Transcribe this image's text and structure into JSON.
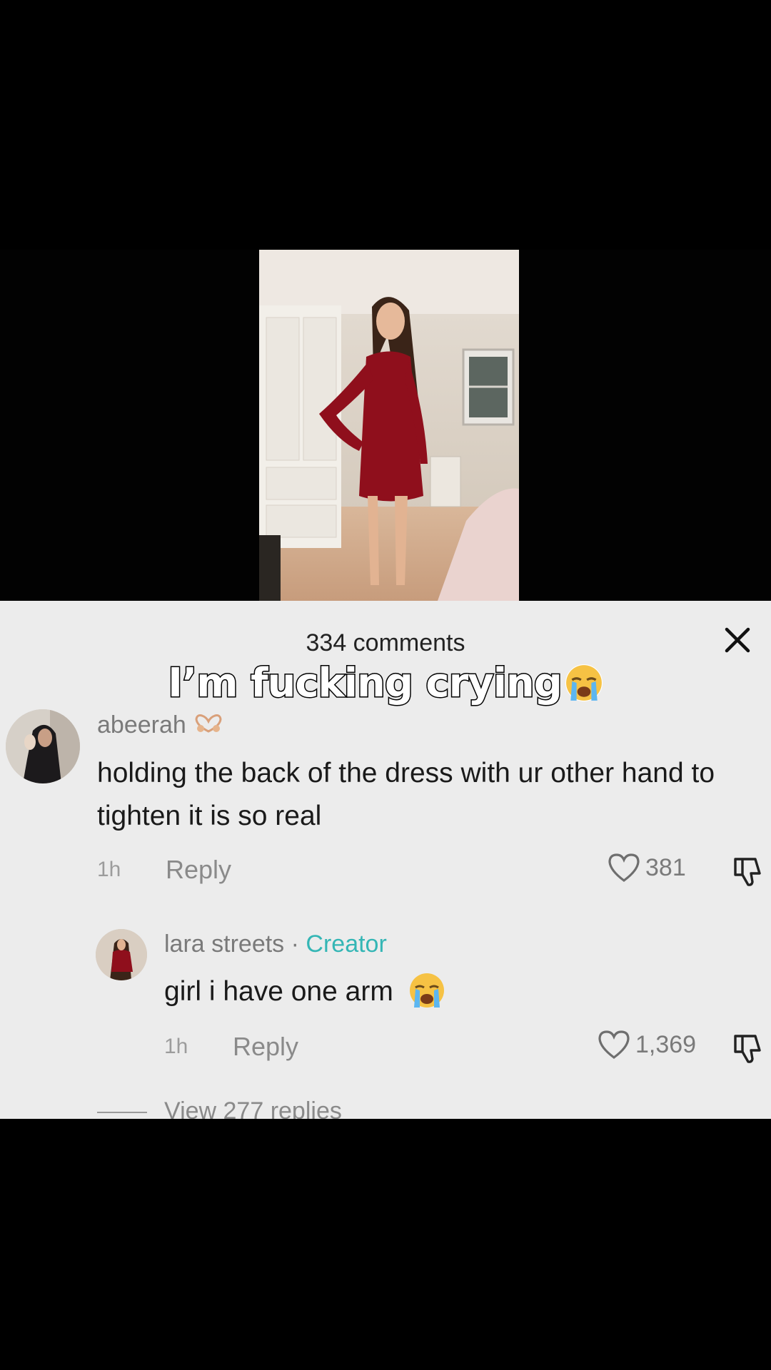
{
  "caption": {
    "text": "I’m fucking crying",
    "emoji_icon": "loudly-crying-face-icon"
  },
  "sheet": {
    "comment_count_label": "334 comments",
    "close_icon": "close-icon"
  },
  "comments": [
    {
      "username": "abeerah",
      "username_icon": "heart-hands-icon",
      "text": "holding the back of the dress with ur other hand to tighten it is so real",
      "time": "1h",
      "reply_label": "Reply",
      "likes": "381"
    },
    {
      "username": "lara streets",
      "separator": " · ",
      "badge": "Creator",
      "text": "girl i have one arm",
      "text_icon": "loudly-crying-face-icon",
      "time": "1h",
      "reply_label": "Reply",
      "likes": "1,369"
    }
  ],
  "view_replies_label": "View 277 replies",
  "colors": {
    "creator_badge": "#34b6b5",
    "sheet_bg": "#ececec",
    "dress": "#8f0f1c"
  }
}
